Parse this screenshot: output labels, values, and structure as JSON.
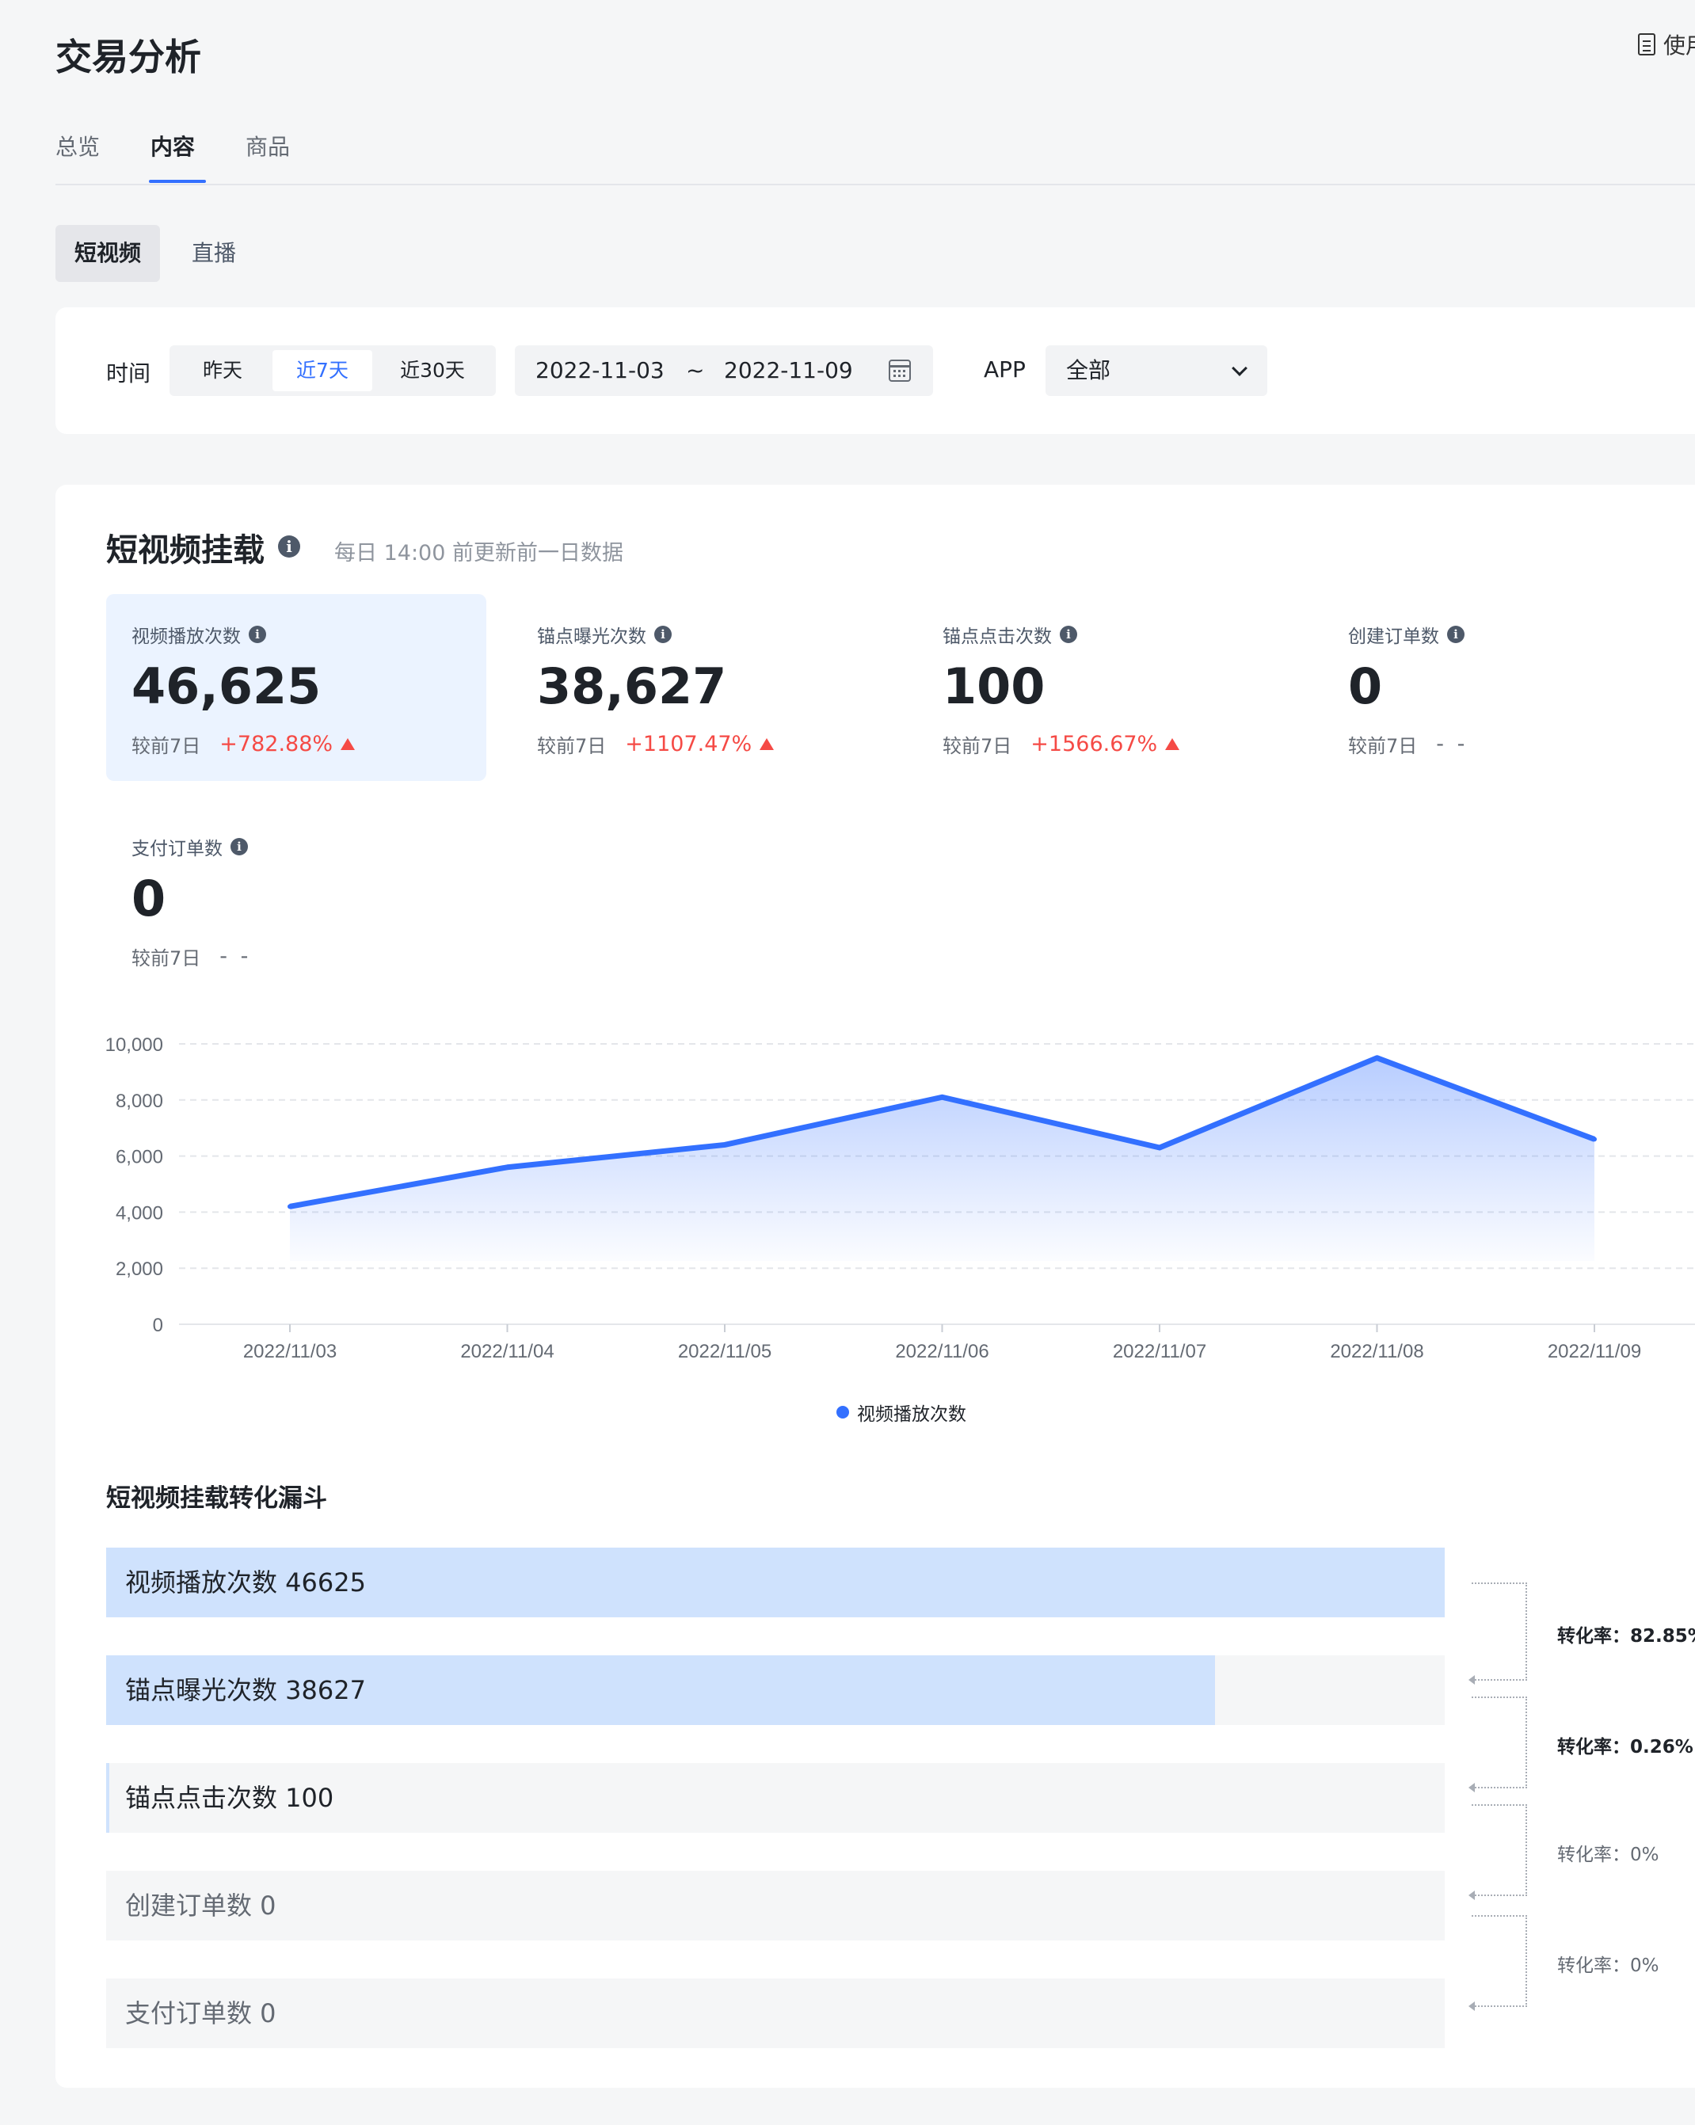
{
  "page": {
    "title": "交易分析",
    "help_link": "使用说明"
  },
  "tabs": [
    {
      "label": "总览",
      "active": false
    },
    {
      "label": "内容",
      "active": true
    },
    {
      "label": "商品",
      "active": false
    }
  ],
  "subtabs": [
    {
      "label": "短视频",
      "active": true
    },
    {
      "label": "直播",
      "active": false
    }
  ],
  "filters": {
    "time_label": "时间",
    "time_options": [
      {
        "label": "昨天",
        "active": false
      },
      {
        "label": "近7天",
        "active": true
      },
      {
        "label": "近30天",
        "active": false
      }
    ],
    "date_start": "2022-11-03",
    "date_sep": "~",
    "date_end": "2022-11-09",
    "app_label": "APP",
    "app_value": "全部"
  },
  "section": {
    "title": "短视频挂载",
    "update_note": "每日 14:00 前更新前一日数据"
  },
  "metrics": [
    {
      "label": "视频播放次数",
      "value": "46,625",
      "compare_label": "较前7日",
      "change": "+782.88%",
      "trend": "up",
      "active": true
    },
    {
      "label": "锚点曝光次数",
      "value": "38,627",
      "compare_label": "较前7日",
      "change": "+1107.47%",
      "trend": "up",
      "active": false
    },
    {
      "label": "锚点点击次数",
      "value": "100",
      "compare_label": "较前7日",
      "change": "+1566.67%",
      "trend": "up",
      "active": false
    },
    {
      "label": "创建订单数",
      "value": "0",
      "compare_label": "较前7日",
      "change": "- -",
      "trend": "none",
      "active": false
    },
    {
      "label": "支付订单数",
      "value": "0",
      "compare_label": "较前7日",
      "change": "- -",
      "trend": "none",
      "active": false
    }
  ],
  "chart_data": {
    "type": "area",
    "categories": [
      "2022/11/03",
      "2022/11/04",
      "2022/11/05",
      "2022/11/06",
      "2022/11/07",
      "2022/11/08",
      "2022/11/09"
    ],
    "series": [
      {
        "name": "视频播放次数",
        "values": [
          4200,
          5600,
          6400,
          8100,
          6300,
          9500,
          6600
        ]
      }
    ],
    "y_ticks": [
      "0",
      "2,000",
      "4,000",
      "6,000",
      "8,000",
      "10,000"
    ],
    "ylim": [
      0,
      10000
    ],
    "grid": true,
    "legend_position": "bottom-center",
    "line_color": "#3370ff"
  },
  "funnel": {
    "title": "短视频挂载转化漏斗",
    "steps": [
      {
        "label": "视频播放次数 46625",
        "fraction": 1.0,
        "muted": false
      },
      {
        "label": "锚点曝光次数 38627",
        "fraction": 0.8285,
        "muted": false
      },
      {
        "label": "锚点点击次数 100",
        "fraction": 0.0021,
        "muted": false
      },
      {
        "label": "创建订单数 0",
        "fraction": 0,
        "muted": true
      },
      {
        "label": "支付订单数 0",
        "fraction": 0,
        "muted": true
      }
    ],
    "conversions": [
      {
        "label": "转化率：82.85%",
        "strong": true
      },
      {
        "label": "转化率：0.26%",
        "strong": true
      },
      {
        "label": "转化率：0%",
        "strong": false
      },
      {
        "label": "转化率：0%",
        "strong": false
      }
    ]
  }
}
